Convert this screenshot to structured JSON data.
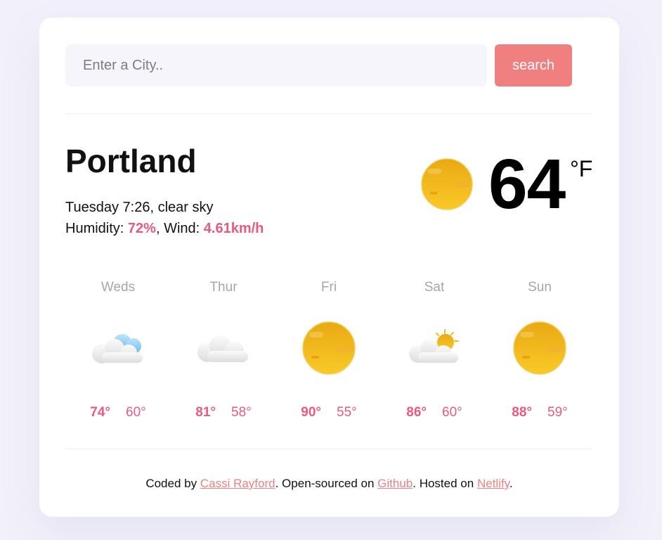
{
  "search": {
    "placeholder": "Enter a City..",
    "button_label": "search"
  },
  "current": {
    "city": "Portland",
    "datetime": "Tuesday 7:26",
    "description": "clear sky",
    "humidity_label": "Humidity:",
    "humidity_value": "72%",
    "wind_label": "Wind:",
    "wind_value": "4.61km/h",
    "temperature": "64",
    "unit": "°F",
    "icon": "sun-icon"
  },
  "forecast": [
    {
      "day": "Weds",
      "icon": "cloud-icon",
      "max": "74°",
      "min": "60°"
    },
    {
      "day": "Thur",
      "icon": "cloud-icon",
      "max": "81°",
      "min": "58°"
    },
    {
      "day": "Fri",
      "icon": "sun-icon",
      "max": "90°",
      "min": "55°"
    },
    {
      "day": "Sat",
      "icon": "partly-cloudy-icon",
      "max": "86°",
      "min": "60°"
    },
    {
      "day": "Sun",
      "icon": "sun-icon",
      "max": "88°",
      "min": "59°"
    }
  ],
  "footer": {
    "prefix": "Coded by",
    "author": "Cassi Rayford",
    "middle1": ". Open-sourced on",
    "github": "Github",
    "middle2": ". Hosted on",
    "host": "Netlify",
    "suffix": "."
  },
  "colors": {
    "accent": "#ea5a80",
    "button": "#f08080",
    "background": "#f2f1fa",
    "sun": "#f3b81c"
  }
}
